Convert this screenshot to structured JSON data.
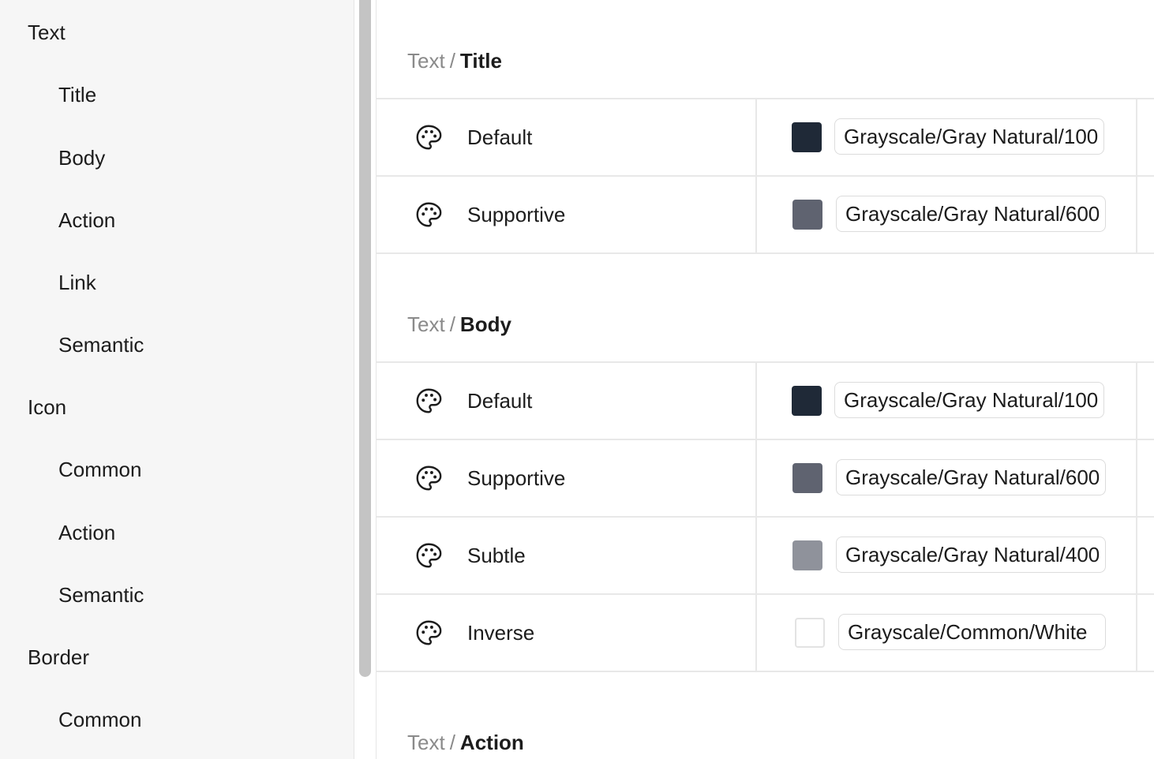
{
  "sidebar": {
    "items": [
      {
        "label": "Text",
        "level": "group"
      },
      {
        "label": "Title",
        "level": "child"
      },
      {
        "label": "Body",
        "level": "child"
      },
      {
        "label": "Action",
        "level": "child"
      },
      {
        "label": "Link",
        "level": "child"
      },
      {
        "label": "Semantic",
        "level": "child"
      },
      {
        "label": "Icon",
        "level": "group"
      },
      {
        "label": "Common",
        "level": "child"
      },
      {
        "label": "Action",
        "level": "child"
      },
      {
        "label": "Semantic",
        "level": "child"
      },
      {
        "label": "Border",
        "level": "group"
      },
      {
        "label": "Common",
        "level": "child"
      }
    ]
  },
  "sections": [
    {
      "prefix": "Text",
      "separator": "/",
      "name": "Title",
      "rows": [
        {
          "label": "Default",
          "swatch_color": "#1f2937",
          "token": "Grayscale/Gray Natural/100"
        },
        {
          "label": "Supportive",
          "swatch_color": "#5f6370",
          "token": "Grayscale/Gray Natural/600"
        }
      ]
    },
    {
      "prefix": "Text",
      "separator": "/",
      "name": "Body",
      "rows": [
        {
          "label": "Default",
          "swatch_color": "#1f2937",
          "token": "Grayscale/Gray Natural/100"
        },
        {
          "label": "Supportive",
          "swatch_color": "#5f6370",
          "token": "Grayscale/Gray Natural/600"
        },
        {
          "label": "Subtle",
          "swatch_color": "#8f929b",
          "token": "Grayscale/Gray Natural/400"
        },
        {
          "label": "Inverse",
          "swatch_color": "#ffffff",
          "token": "Grayscale/Common/White"
        }
      ]
    },
    {
      "prefix": "Text",
      "separator": "/",
      "name": "Action",
      "rows": []
    }
  ],
  "icons": {
    "row_icon": "palette-icon"
  },
  "colors": {
    "sidebar_bg": "#f6f6f6",
    "divider": "#e8e8e8",
    "muted_text": "#8a8a8a"
  }
}
